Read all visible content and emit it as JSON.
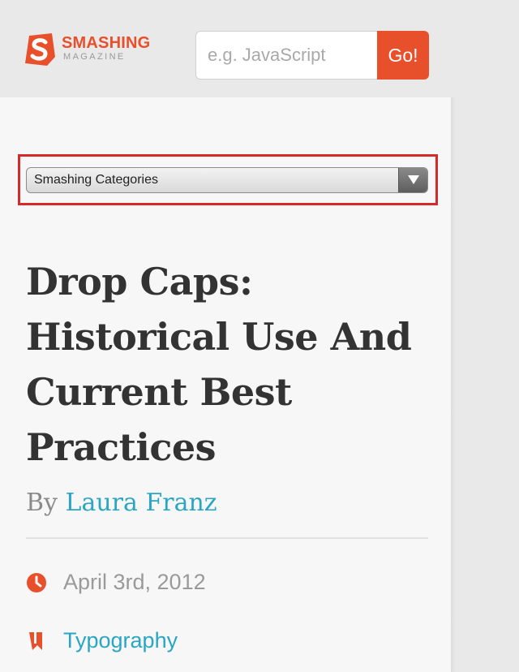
{
  "header": {
    "logo": {
      "wordmark": "SMASHING",
      "subline": "MAGAZINE",
      "icon": "smashing-s-logo-icon"
    },
    "search": {
      "placeholder": "e.g. JavaScript",
      "value": "",
      "button_label": "Go!"
    }
  },
  "nav": {
    "category_select": {
      "selected": "Smashing Categories",
      "icon": "chevron-down-icon"
    }
  },
  "article": {
    "title": "Drop Caps: Historical Use And Current Best Practices",
    "byline_prefix": "By",
    "author": "Laura Franz",
    "date": "April 3rd, 2012",
    "date_icon": "clock-icon",
    "category": "Typography",
    "category_icon": "bookmark-icon"
  },
  "colors": {
    "accent": "#e8502b",
    "link": "#2aa6c4",
    "highlight": "#d42a2a",
    "title": "#333333",
    "meta_text": "#9a9a9a"
  }
}
